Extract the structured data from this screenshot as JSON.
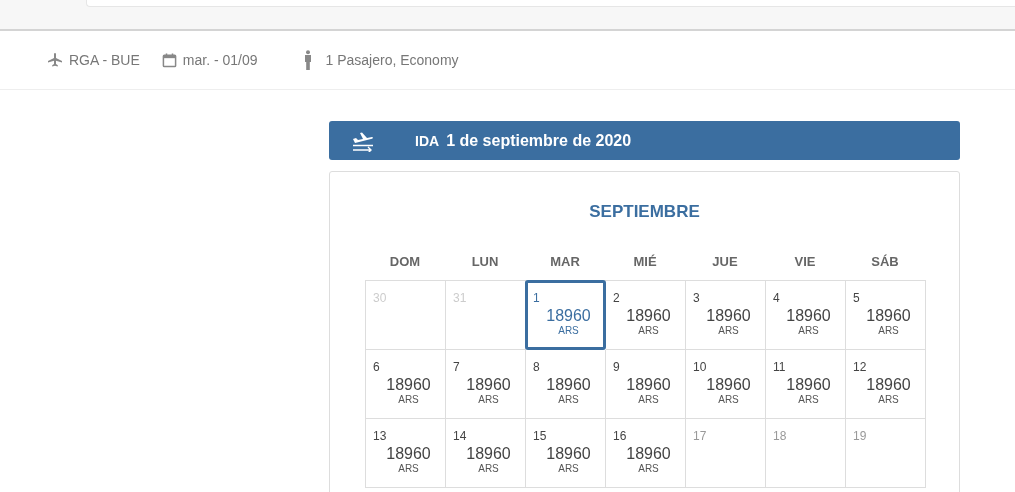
{
  "summary": {
    "route": "RGA - BUE",
    "date": "mar. - 01/09",
    "passengers": "1 Pasajero, Economy"
  },
  "leg": {
    "label": "IDA",
    "date": "1 de septiembre de 2020"
  },
  "calendar": {
    "month": "SEPTIEMBRE",
    "weekdays": [
      "DOM",
      "LUN",
      "MAR",
      "MIÉ",
      "JUE",
      "VIE",
      "SÁB"
    ],
    "days": [
      {
        "day": "30",
        "kind": "other_month",
        "selected": false
      },
      {
        "day": "31",
        "kind": "other_month",
        "selected": false
      },
      {
        "day": "1",
        "kind": "available",
        "price": "18960",
        "currency": "ARS",
        "selected": true
      },
      {
        "day": "2",
        "kind": "available",
        "price": "18960",
        "currency": "ARS",
        "selected": false
      },
      {
        "day": "3",
        "kind": "available",
        "price": "18960",
        "currency": "ARS",
        "selected": false
      },
      {
        "day": "4",
        "kind": "available",
        "price": "18960",
        "currency": "ARS",
        "selected": false
      },
      {
        "day": "5",
        "kind": "available",
        "price": "18960",
        "currency": "ARS",
        "selected": false
      },
      {
        "day": "6",
        "kind": "available",
        "price": "18960",
        "currency": "ARS",
        "selected": false
      },
      {
        "day": "7",
        "kind": "available",
        "price": "18960",
        "currency": "ARS",
        "selected": false
      },
      {
        "day": "8",
        "kind": "available",
        "price": "18960",
        "currency": "ARS",
        "selected": false
      },
      {
        "day": "9",
        "kind": "available",
        "price": "18960",
        "currency": "ARS",
        "selected": false
      },
      {
        "day": "10",
        "kind": "available",
        "price": "18960",
        "currency": "ARS",
        "selected": false
      },
      {
        "day": "11",
        "kind": "available",
        "price": "18960",
        "currency": "ARS",
        "selected": false
      },
      {
        "day": "12",
        "kind": "available",
        "price": "18960",
        "currency": "ARS",
        "selected": false
      },
      {
        "day": "13",
        "kind": "available",
        "price": "18960",
        "currency": "ARS",
        "selected": false
      },
      {
        "day": "14",
        "kind": "available",
        "price": "18960",
        "currency": "ARS",
        "selected": false
      },
      {
        "day": "15",
        "kind": "available",
        "price": "18960",
        "currency": "ARS",
        "selected": false
      },
      {
        "day": "16",
        "kind": "available",
        "price": "18960",
        "currency": "ARS",
        "selected": false
      },
      {
        "day": "17",
        "kind": "unavailable",
        "selected": false
      },
      {
        "day": "18",
        "kind": "unavailable",
        "selected": false
      },
      {
        "day": "19",
        "kind": "unavailable",
        "selected": false
      }
    ]
  }
}
